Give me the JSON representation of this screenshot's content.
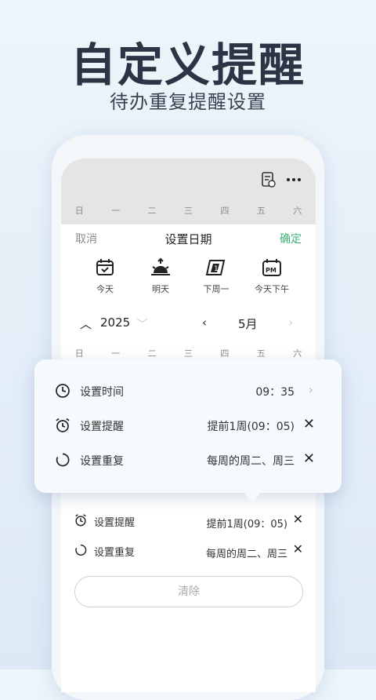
{
  "headline": "自定义提醒",
  "subline": "待办重复提醒设置",
  "weekdays": [
    "日",
    "一",
    "二",
    "三",
    "四",
    "五",
    "六"
  ],
  "sheet": {
    "cancel": "取消",
    "title": "设置日期",
    "confirm": "确定"
  },
  "quick_dates": [
    {
      "label": "今天",
      "icon": "calendar-check-icon"
    },
    {
      "label": "明天",
      "icon": "sunrise-icon"
    },
    {
      "label": "下周一",
      "icon": "calendar-flip-icon"
    },
    {
      "label": "今天下午",
      "icon": "calendar-pm-icon"
    }
  ],
  "year_bar": {
    "year": "2025",
    "month": "5月"
  },
  "popup": {
    "time_label": "设置时间",
    "time_value": "09：35",
    "remind_label": "设置提醒",
    "remind_value": "提前1周(09：05)",
    "repeat_label": "设置重复",
    "repeat_value": "每周的周二、周三"
  },
  "list": {
    "remind_label": "设置提醒",
    "remind_value": "提前1周(09：05)",
    "repeat_label": "设置重复",
    "repeat_value": "每周的周二、周三"
  },
  "clear_label": "清除",
  "colors": {
    "accent": "#3cb371",
    "title": "#2e3446"
  }
}
